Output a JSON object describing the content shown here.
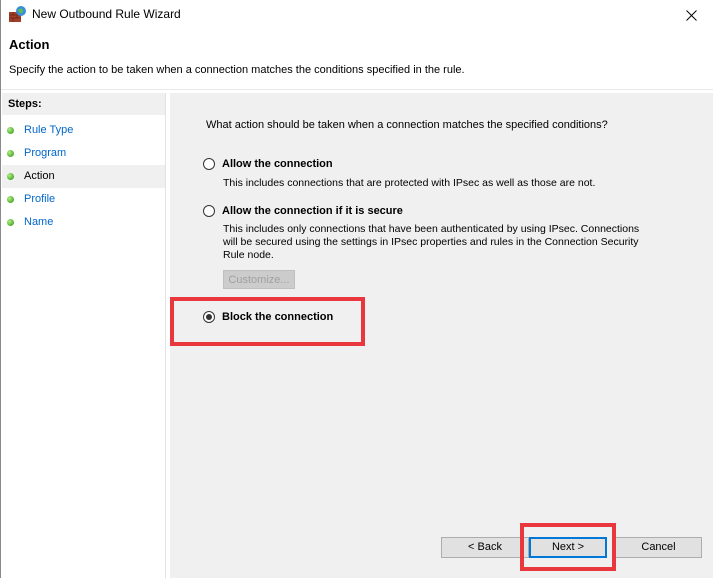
{
  "window": {
    "title": "New Outbound Rule Wizard",
    "app_icon": "firewall-globe-icon",
    "close_icon": "close-icon"
  },
  "header": {
    "title": "Action",
    "description": "Specify the action to be taken when a connection matches the conditions specified in the rule."
  },
  "steps": {
    "heading": "Steps:",
    "items": [
      {
        "label": "Rule Type",
        "current": false
      },
      {
        "label": "Program",
        "current": false
      },
      {
        "label": "Action",
        "current": true
      },
      {
        "label": "Profile",
        "current": false
      },
      {
        "label": "Name",
        "current": false
      }
    ]
  },
  "main": {
    "question": "What action should be taken when a connection matches the specified conditions?",
    "options": [
      {
        "label": "Allow the connection",
        "description": "This includes connections that are protected with IPsec as well as those are not.",
        "selected": false
      },
      {
        "label": "Allow the connection if it is secure",
        "description": "This includes only connections that have been authenticated by using IPsec.  Connections will be secured using the settings in IPsec properties and rules in the Connection Security Rule node.",
        "selected": false
      },
      {
        "label": "Block the connection",
        "description": "",
        "selected": true
      }
    ],
    "customize_label": "Customize..."
  },
  "buttons": {
    "back": "< Back",
    "next": "Next >",
    "cancel": "Cancel"
  },
  "colors": {
    "highlight": "#e8383d",
    "link": "#0066cc",
    "focus": "#0078d7"
  }
}
